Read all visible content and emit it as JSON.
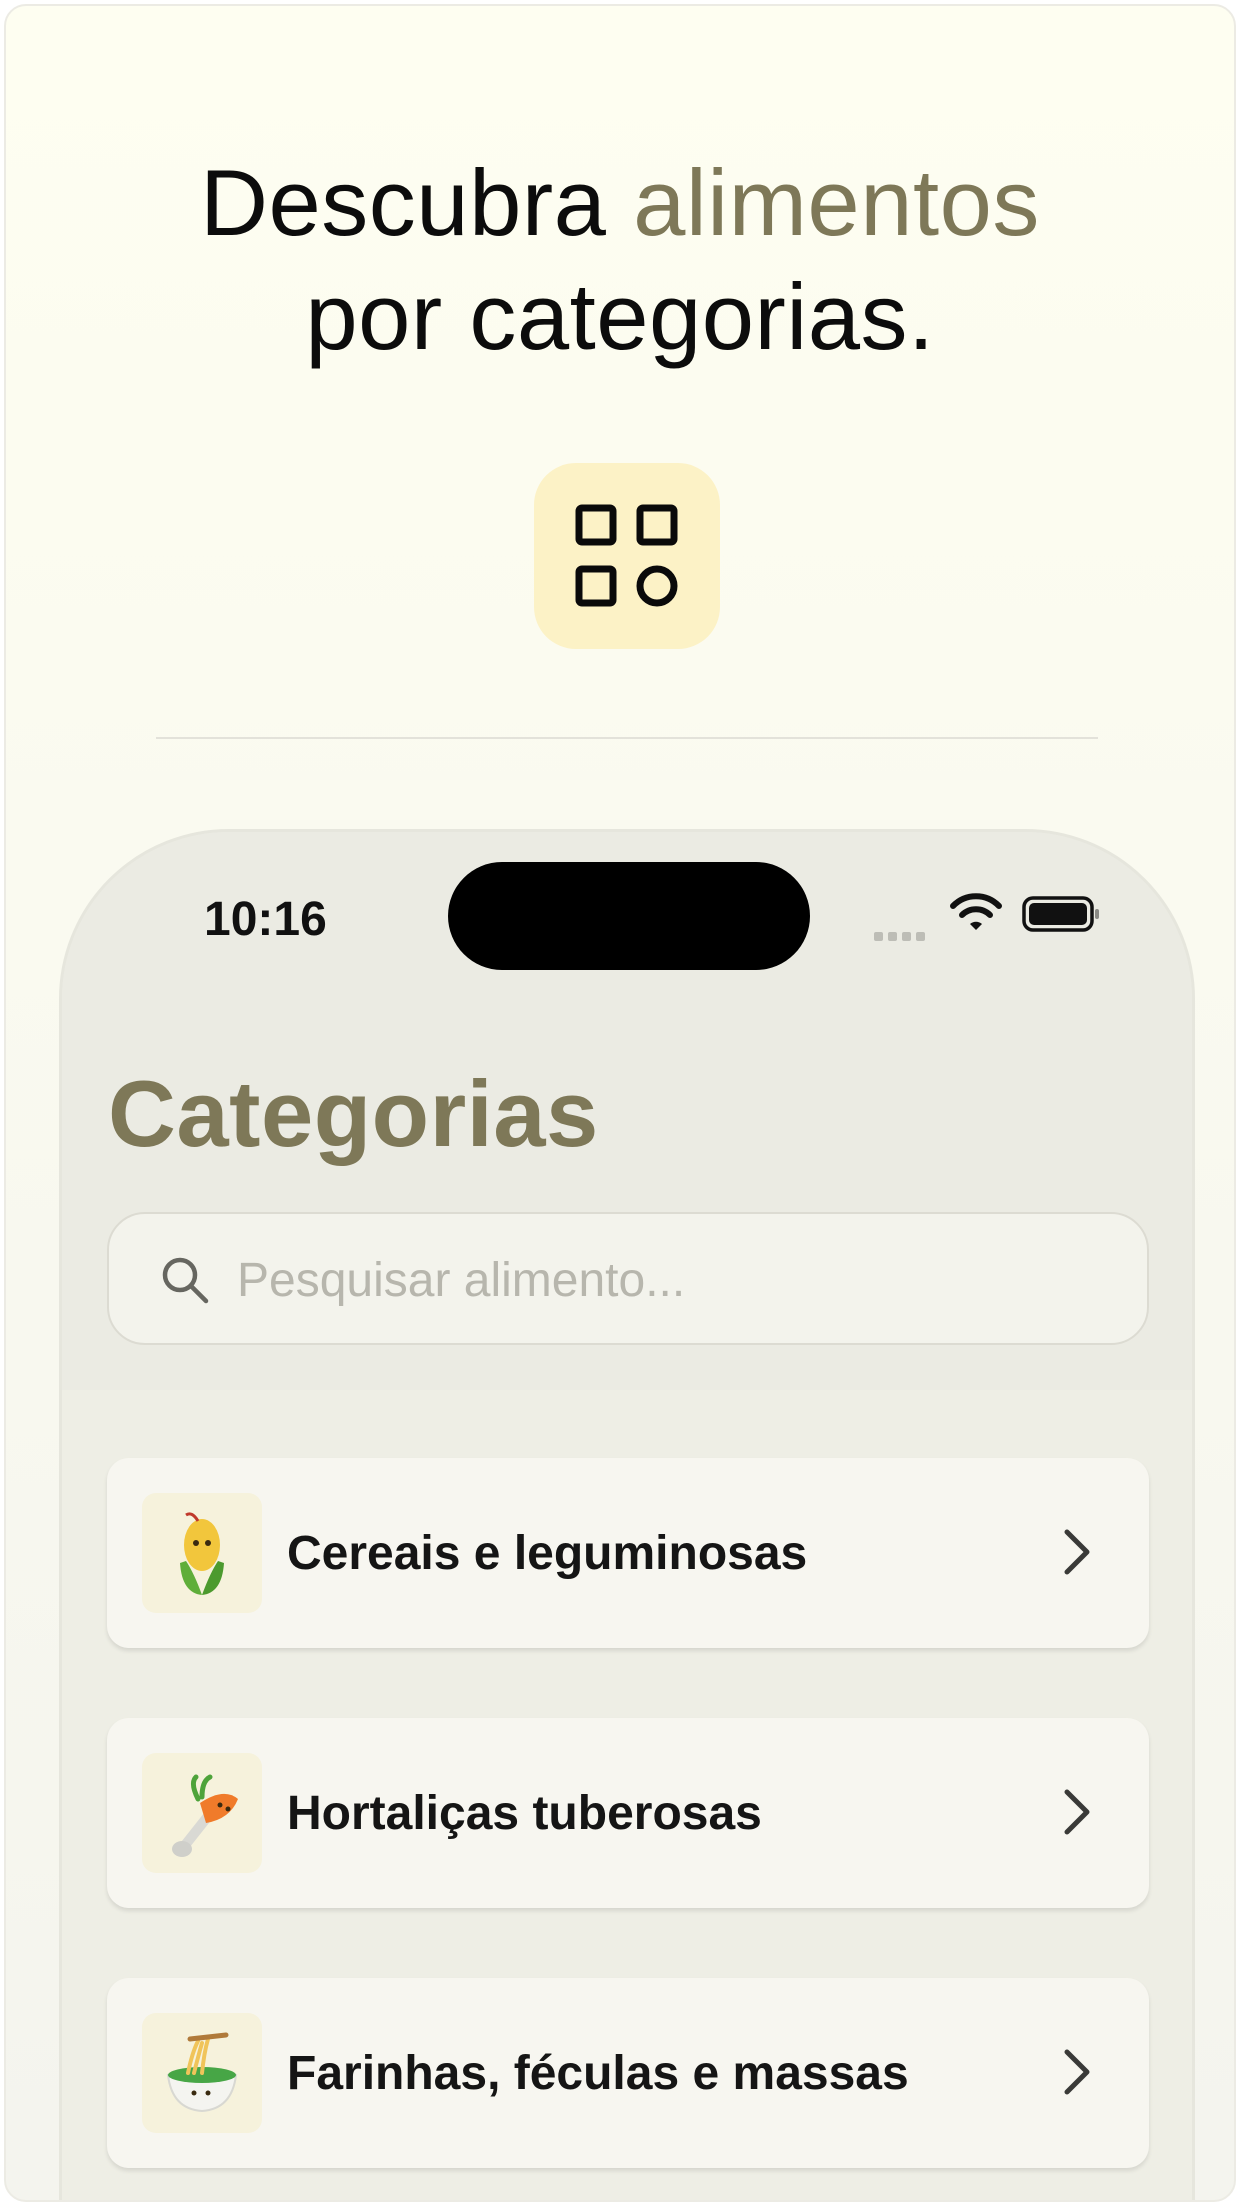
{
  "headline": {
    "line1_plain": "Descubra",
    "line1_accent": "alimentos",
    "line2": "por categorias."
  },
  "app_icon": "grid-shapes-icon",
  "status_bar": {
    "time": "10:16",
    "icons": [
      "signal-icon",
      "wifi-icon",
      "battery-icon"
    ]
  },
  "screen": {
    "title": "Categorias",
    "search": {
      "placeholder": "Pesquisar alimento...",
      "value": "",
      "icon": "search-icon"
    },
    "categories": [
      {
        "label": "Cereais e leguminosas",
        "icon": "corn-icon"
      },
      {
        "label": "Hortaliças tuberosas",
        "icon": "carrot-icon"
      },
      {
        "label": "Farinhas, féculas e massas",
        "icon": "noodle-bowl-icon"
      }
    ]
  },
  "colors": {
    "accent": "#7e7858",
    "background": "#fefef1",
    "icon_tile": "#fcf2c6",
    "text": "#0c0c0c"
  }
}
